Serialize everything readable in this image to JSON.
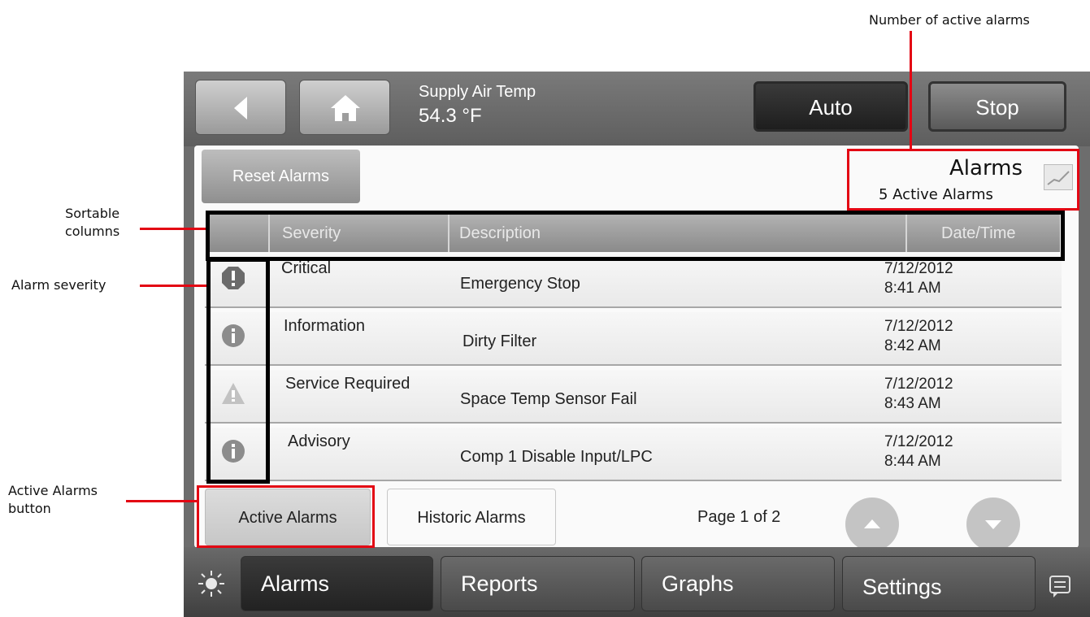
{
  "annotations": {
    "active_alarm_count": "Number of active alarms",
    "sortable_line1": "Sortable",
    "sortable_line2": "columns",
    "alarm_severity": "Alarm severity",
    "active_btn_line1": "Active Alarms",
    "active_btn_line2": "button"
  },
  "topbar": {
    "supply_label": "Supply Air Temp",
    "supply_value": "54.3 °F",
    "auto_label": "Auto",
    "stop_label": "Stop"
  },
  "alarms_panel": {
    "reset_label": "Reset Alarms",
    "title": "Alarms",
    "active_count": "5 Active Alarms",
    "columns": [
      "",
      "Severity",
      "Description",
      "Date/Time"
    ],
    "rows": [
      {
        "severity": "Critical",
        "icon": "critical-octagon-icon",
        "description": "Emergency Stop",
        "date": "7/12/2012",
        "time": "8:41 AM"
      },
      {
        "severity": "Information",
        "icon": "info-icon",
        "description": "Dirty Filter",
        "date": "7/12/2012",
        "time": "8:42 AM"
      },
      {
        "severity": "Service Required",
        "icon": "warning-triangle-icon",
        "description": "Space Temp Sensor Fail",
        "date": "7/12/2012",
        "time": "8:43 AM"
      },
      {
        "severity": "Advisory",
        "icon": "info-icon",
        "description": "Comp 1 Disable Input/LPC",
        "date": "7/12/2012",
        "time": "8:44 AM"
      }
    ],
    "active_tab": "Active Alarms",
    "historic_tab": "Historic Alarms",
    "page_info": "Page 1 of 2"
  },
  "bottom_nav": {
    "alarms": "Alarms",
    "reports": "Reports",
    "graphs": "Graphs",
    "settings": "Settings"
  },
  "colors": {
    "annotation_red": "#e30613",
    "screen_gray": "#6d6d6d"
  }
}
